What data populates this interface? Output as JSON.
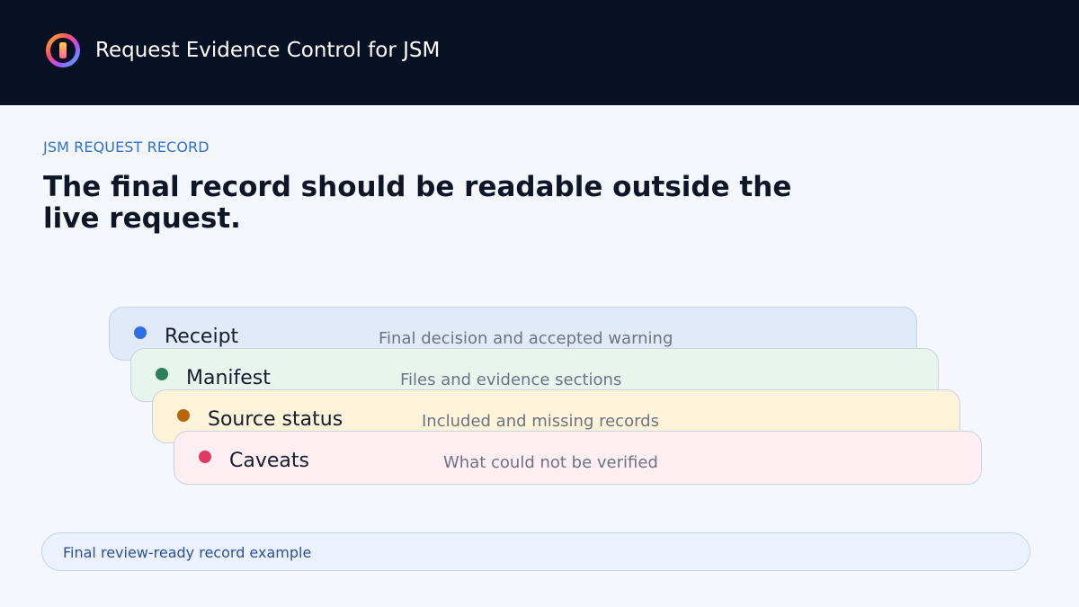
{
  "header": {
    "app_title": "Request Evidence Control for JSM",
    "logo_icon": "app-logo-ring-icon"
  },
  "content": {
    "eyebrow": "JSM REQUEST RECORD",
    "title": "The final record should be readable outside the live request."
  },
  "cards": [
    {
      "title": "Receipt",
      "description": "Final decision and accepted warning",
      "dot_color": "#2f6fe6",
      "bg_color": "#e0eafb"
    },
    {
      "title": "Manifest",
      "description": "Files and evidence sections",
      "dot_color": "#2e7d5b",
      "bg_color": "#e8f5ec"
    },
    {
      "title": "Source status",
      "description": "Included and missing records",
      "dot_color": "#b8650e",
      "bg_color": "#fdf3d9"
    },
    {
      "title": "Caveats",
      "description": "What could not be verified",
      "dot_color": "#e23a63",
      "bg_color": "#fdeff1"
    }
  ],
  "footer": {
    "label": "Final review-ready record example"
  }
}
